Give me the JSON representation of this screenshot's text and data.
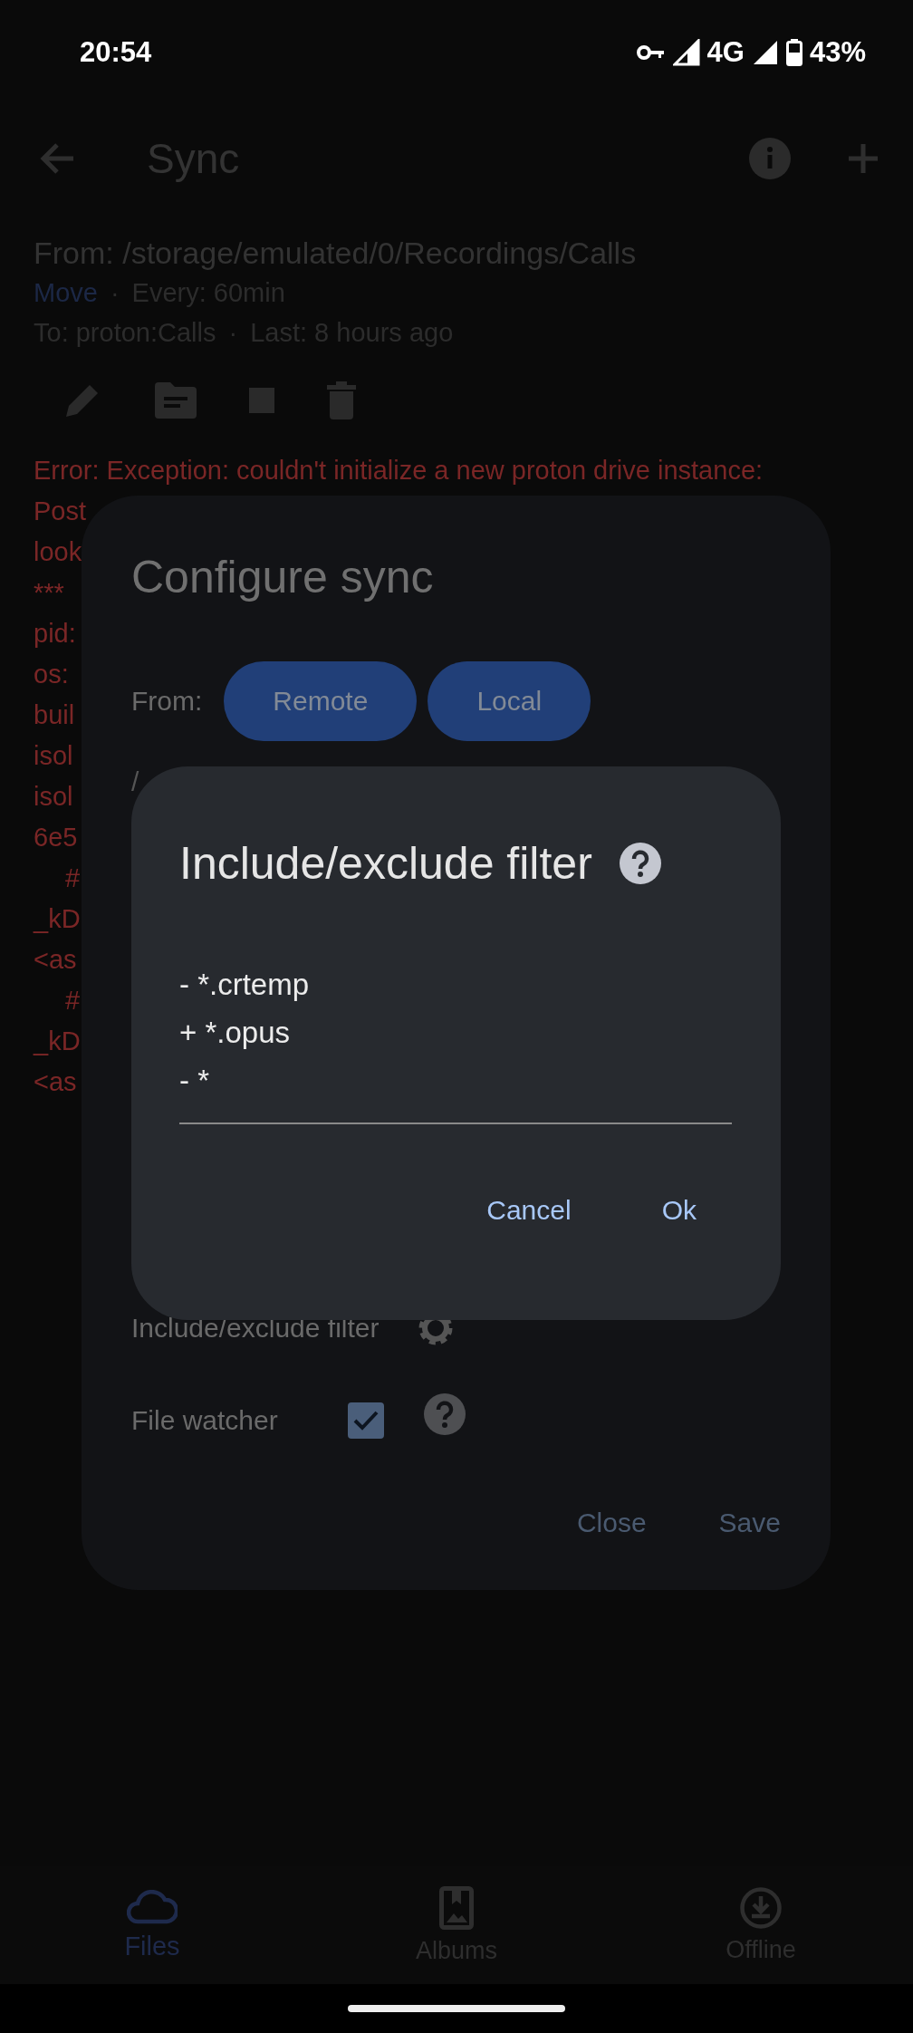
{
  "status_bar": {
    "time": "20:54",
    "network": "4G",
    "battery": "43%"
  },
  "app_bar": {
    "title": "Sync"
  },
  "sync_job": {
    "from": "From: /storage/emulated/0/Recordings/Calls",
    "meta_rows": [
      [
        {
          "kind": "link",
          "text": "Move"
        },
        {
          "kind": "dot",
          "text": "·"
        },
        {
          "kind": "plain",
          "text": "Every: 60min"
        }
      ],
      [
        {
          "kind": "plain",
          "text": "To: proton:Calls"
        },
        {
          "kind": "dot",
          "text": "·"
        },
        {
          "kind": "plain",
          "text": "Last: 8 hours ago"
        }
      ]
    ]
  },
  "error_lines": [
    {
      "kind": "plain",
      "text": "Error: Exception: couldn't initialize a new proton drive instance:"
    },
    {
      "kind": "plain",
      "text": "Post"
    },
    {
      "kind": "plain",
      "text": "look"
    },
    {
      "kind": "plain",
      "text": "***"
    },
    {
      "kind": "plain",
      "text": "pid:"
    },
    {
      "kind": "plain",
      "text": "os:"
    },
    {
      "kind": "plain",
      "text": "buil"
    },
    {
      "kind": "plain",
      "text": "isol"
    },
    {
      "kind": "plain",
      "text": "isol"
    },
    {
      "kind": "plain",
      "text": "6e5"
    },
    {
      "kind": "indented",
      "text": "#"
    },
    {
      "kind": "plain",
      "text": "_kD"
    },
    {
      "kind": "plain",
      "text": "<as"
    },
    {
      "kind": "indented",
      "text": "#"
    },
    {
      "kind": "plain",
      "text": "_kD"
    },
    {
      "kind": "plain",
      "text": "<as"
    }
  ],
  "configure_dialog": {
    "title": "Configure sync",
    "from_label": "From:",
    "source_buttons": [
      "Remote",
      "Local"
    ],
    "path_fragment": "/",
    "filter_label": "Include/exclude filter",
    "file_watcher": {
      "label": "File watcher",
      "checked": true
    },
    "actions": [
      "Close",
      "Save"
    ]
  },
  "filter_dialog": {
    "title": "Include/exclude filter",
    "value": "- *.crtemp\n+ *.opus\n- *",
    "actions": [
      "Cancel",
      "Ok"
    ]
  },
  "bottom_nav": [
    {
      "label": "Files",
      "selected": true
    },
    {
      "label": "Albums",
      "selected": false
    },
    {
      "label": "Offline",
      "selected": false
    }
  ]
}
